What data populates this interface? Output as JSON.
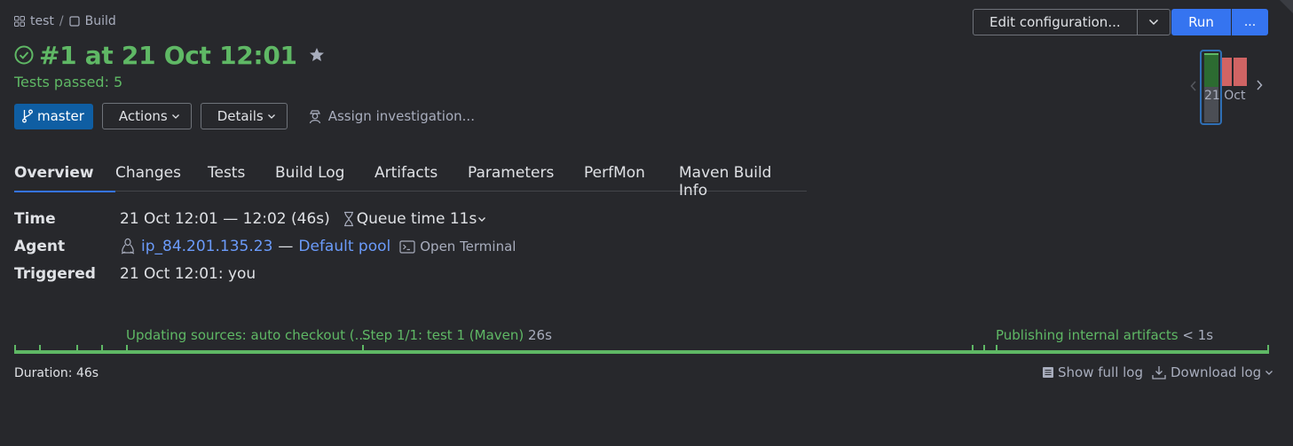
{
  "breadcrumb": {
    "project": "test",
    "separator": "/",
    "config": "Build"
  },
  "build": {
    "title": "#1 at 21 Oct 12:01",
    "status_text": "Tests passed: 5",
    "status_color": "#5fb865"
  },
  "actions": {
    "branch": "master",
    "actions_label": "Actions",
    "details_label": "Details",
    "assign_label": "Assign investigation..."
  },
  "toolbar": {
    "edit_label": "Edit configuration...",
    "run_label": "Run",
    "run_more_label": "..."
  },
  "history": {
    "date_label": "21 Oct"
  },
  "tabs": [
    {
      "label": "Overview"
    },
    {
      "label": "Changes"
    },
    {
      "label": "Tests"
    },
    {
      "label": "Build Log"
    },
    {
      "label": "Artifacts"
    },
    {
      "label": "Parameters"
    },
    {
      "label": "PerfMon"
    },
    {
      "label": "Maven Build Info"
    }
  ],
  "info": {
    "time_label": "Time",
    "time_value": "21 Oct 12:01 — 12:02 (46s)",
    "queue_label": "Queue time 11s",
    "agent_label": "Agent",
    "agent_name": "ip_84.201.135.23",
    "agent_sep": "—",
    "agent_pool": "Default pool",
    "open_terminal": "Open Terminal",
    "triggered_label": "Triggered",
    "triggered_value": "21 Oct 12:01: you"
  },
  "timeline": {
    "step1": "Updating sources: auto checkout (...",
    "step2": "Step 1/1: test 1 (Maven)",
    "step2_time": "26s",
    "step3": "Publishing internal artifacts",
    "step3_time": "< 1s"
  },
  "footer": {
    "duration": "Duration: 46s",
    "show_log": "Show full log",
    "download_log": "Download log"
  },
  "colors": {
    "accent": "#3574f0",
    "success": "#5fb865",
    "branch": "#0f5ea3",
    "failed": "#d06464"
  }
}
